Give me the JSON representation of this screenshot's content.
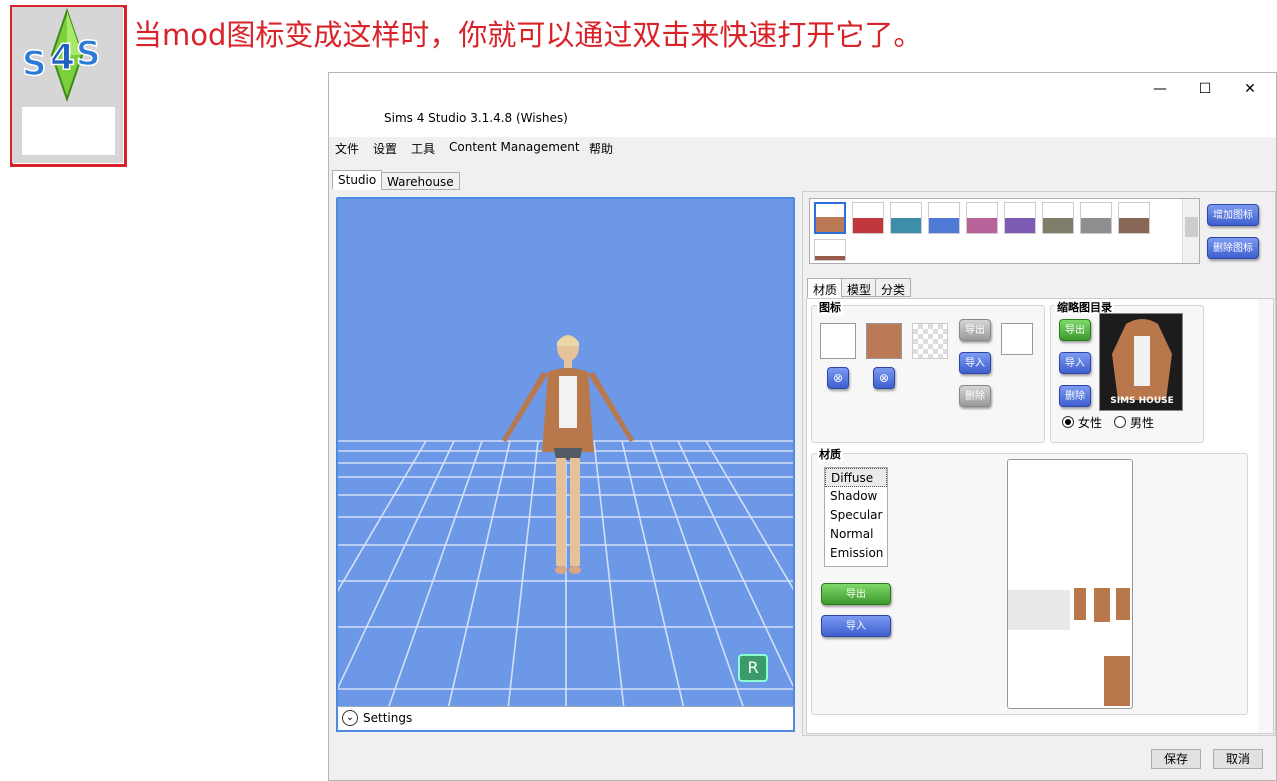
{
  "annotation": {
    "caption": "当mod图标变成这样时，你就可以通过双击来快速打开它了。",
    "logo_text": "s4S"
  },
  "window": {
    "title": "Sims 4 Studio 3.1.4.8 (Wishes)",
    "minimize": "—",
    "maximize": "☐",
    "close": "✕"
  },
  "menu": [
    "文件",
    "设置",
    "工具",
    "Content Management",
    "帮助"
  ],
  "tabs": {
    "studio": "Studio",
    "warehouse": "Warehouse"
  },
  "viewport": {
    "settings_label": "Settings",
    "rig_badge": "R"
  },
  "swatches": {
    "colors": [
      "#b97a55",
      "#c0373c",
      "#3d8dab",
      "#4f79d4",
      "#b9639a",
      "#7e5cb3",
      "#7d7d6a",
      "#8e8e8e",
      "#8a6858",
      "#9a5a49"
    ],
    "add_label": "增加图标",
    "delete_label": "删除图标"
  },
  "subtabs": {
    "material": "材质",
    "model": "模型",
    "category": "分类"
  },
  "icon_group": {
    "title": "图标",
    "export": "导出",
    "import": "导入",
    "delete": "删除",
    "remove": "⊗"
  },
  "thumbnail_group": {
    "title": "缩略图目录",
    "export": "导出",
    "import": "导入",
    "delete": "删除",
    "watermark": "SIMS HOUSE",
    "female": "女性",
    "male": "男性"
  },
  "material_group": {
    "title": "材质",
    "items": [
      "Diffuse",
      "Shadow",
      "Specular",
      "Normal",
      "Emission"
    ],
    "export": "导出",
    "import": "导入"
  },
  "footer": {
    "save": "保存",
    "cancel": "取消"
  }
}
